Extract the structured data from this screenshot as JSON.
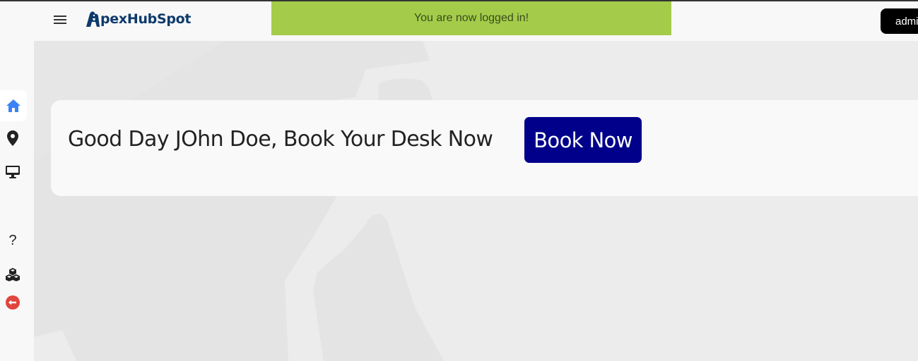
{
  "header": {
    "menu_icon": "hamburger-icon",
    "logo_text": "pexHubSpot",
    "logo_icon": "gorilla-a-logo",
    "brand_color": "#0d3a6b"
  },
  "notification": {
    "message": "You are now logged in!",
    "color": "#a4cc4a"
  },
  "user_menu": {
    "label": "admin"
  },
  "sidebar": {
    "items": [
      {
        "name": "home",
        "icon": "home-icon",
        "active": true,
        "color": "#3b82f6"
      },
      {
        "name": "location",
        "icon": "map-pin-icon"
      },
      {
        "name": "desk",
        "icon": "monitor-icon"
      },
      {
        "name": "help",
        "icon": "question-icon",
        "glyph": "?"
      },
      {
        "name": "resources",
        "icon": "cubes-icon"
      },
      {
        "name": "logout",
        "icon": "logout-icon",
        "color": "#e0453e"
      }
    ]
  },
  "welcome": {
    "greeting": "Good Day JOhn Doe, Book Your Desk Now",
    "button_label": "Book Now",
    "button_color": "#00008b"
  }
}
